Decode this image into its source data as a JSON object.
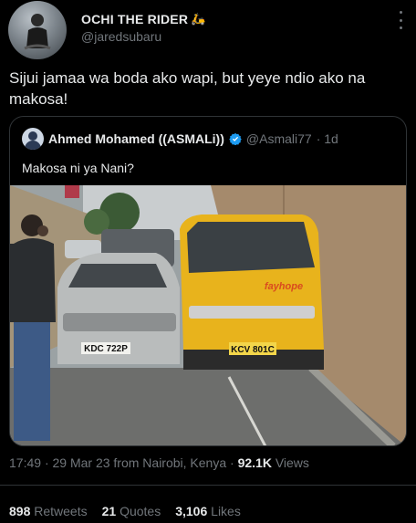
{
  "author": {
    "name": "OCHI THE RIDER",
    "emoji": "🛵",
    "handle": "@jaredsubaru"
  },
  "tweet": {
    "text": "Sijui jamaa wa boda ako wapi, but yeye ndio ako na makosa!"
  },
  "quoted": {
    "name": "Ahmed Mohamed ((ASMALi))",
    "handle": "@Asmali77",
    "time": "· 1d",
    "text": "Makosa ni ya Nani?",
    "photo": {
      "van_brand": "fayhope",
      "van_plate": "KCV 801C",
      "car_plate": "KDC 722P"
    }
  },
  "meta": {
    "time": "17:49",
    "date": "· 29 Mar 23 from Nairobi, Kenya ·",
    "views_value": "92.1K",
    "views_label": "Views"
  },
  "stats": {
    "retweets_value": "898",
    "retweets_label": "Retweets",
    "quotes_value": "21",
    "quotes_label": "Quotes",
    "likes_value": "3,106",
    "likes_label": "Likes"
  },
  "colors": {
    "background": "#000000",
    "text": "#e7e9ea",
    "muted": "#71767b",
    "border": "#2f3336",
    "verified": "#1d9bf0"
  }
}
